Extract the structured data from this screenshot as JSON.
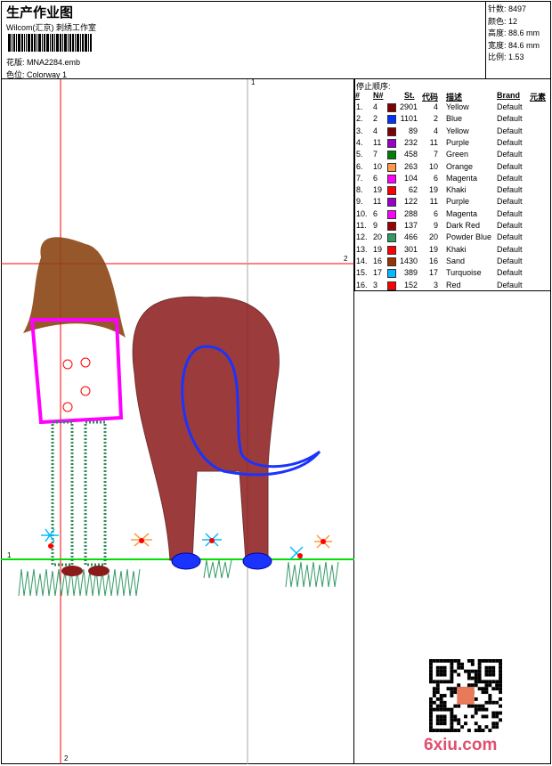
{
  "header": {
    "title": "生产作业图",
    "subtitle": "Wilcom(汇京) 刺绣工作室",
    "design_label": "花版:",
    "design_file": "MNA2284.emb",
    "colorway_label": "色位:",
    "colorway": "Colorway 1"
  },
  "info": [
    {
      "label": "针数:",
      "value": "8497"
    },
    {
      "label": "颜色:",
      "value": "12"
    },
    {
      "label": "高度:",
      "value": "88.6 mm"
    },
    {
      "label": "宽度:",
      "value": "84.6 mm"
    },
    {
      "label": "比例:",
      "value": "1.53"
    }
  ],
  "table": {
    "caption": "停止顺序:",
    "headers": {
      "idx": "#",
      "n": "N#",
      "st": "St.",
      "code": "代码",
      "desc": "描述",
      "brand": "Brand",
      "elem": "元素"
    },
    "rows": [
      {
        "idx": "1.",
        "n": "4",
        "color": "#800000",
        "st": "2901",
        "code": "4",
        "desc": "Yellow",
        "brand": "Default"
      },
      {
        "idx": "2.",
        "n": "2",
        "color": "#0033ff",
        "st": "1101",
        "code": "2",
        "desc": "Blue",
        "brand": "Default"
      },
      {
        "idx": "3.",
        "n": "4",
        "color": "#800000",
        "st": "89",
        "code": "4",
        "desc": "Yellow",
        "brand": "Default"
      },
      {
        "idx": "4.",
        "n": "11",
        "color": "#9900cc",
        "st": "232",
        "code": "11",
        "desc": "Purple",
        "brand": "Default"
      },
      {
        "idx": "5.",
        "n": "7",
        "color": "#008000",
        "st": "458",
        "code": "7",
        "desc": "Green",
        "brand": "Default"
      },
      {
        "idx": "6.",
        "n": "10",
        "color": "#ff9944",
        "st": "263",
        "code": "10",
        "desc": "Orange",
        "brand": "Default"
      },
      {
        "idx": "7.",
        "n": "6",
        "color": "#ff00ff",
        "st": "104",
        "code": "6",
        "desc": "Magenta",
        "brand": "Default"
      },
      {
        "idx": "8.",
        "n": "19",
        "color": "#ff0000",
        "st": "62",
        "code": "19",
        "desc": "Khaki",
        "brand": "Default"
      },
      {
        "idx": "9.",
        "n": "11",
        "color": "#9900cc",
        "st": "122",
        "code": "11",
        "desc": "Purple",
        "brand": "Default"
      },
      {
        "idx": "10.",
        "n": "6",
        "color": "#ff00ff",
        "st": "288",
        "code": "6",
        "desc": "Magenta",
        "brand": "Default"
      },
      {
        "idx": "11.",
        "n": "9",
        "color": "#990000",
        "st": "137",
        "code": "9",
        "desc": "Dark Red",
        "brand": "Default"
      },
      {
        "idx": "12.",
        "n": "20",
        "color": "#339966",
        "st": "466",
        "code": "20",
        "desc": "Powder Blue",
        "brand": "Default"
      },
      {
        "idx": "13.",
        "n": "19",
        "color": "#ff0000",
        "st": "301",
        "code": "19",
        "desc": "Khaki",
        "brand": "Default"
      },
      {
        "idx": "14.",
        "n": "16",
        "color": "#993300",
        "st": "1430",
        "code": "16",
        "desc": "Sand",
        "brand": "Default"
      },
      {
        "idx": "15.",
        "n": "17",
        "color": "#00bbff",
        "st": "389",
        "code": "17",
        "desc": "Turquoise",
        "brand": "Default"
      },
      {
        "idx": "16.",
        "n": "3",
        "color": "#ff0000",
        "st": "152",
        "code": "3",
        "desc": "Red",
        "brand": "Default"
      }
    ]
  },
  "guides": {
    "top": "1",
    "right": "2",
    "bottom": "2",
    "left": "1"
  },
  "watermark": "6xiu.com"
}
